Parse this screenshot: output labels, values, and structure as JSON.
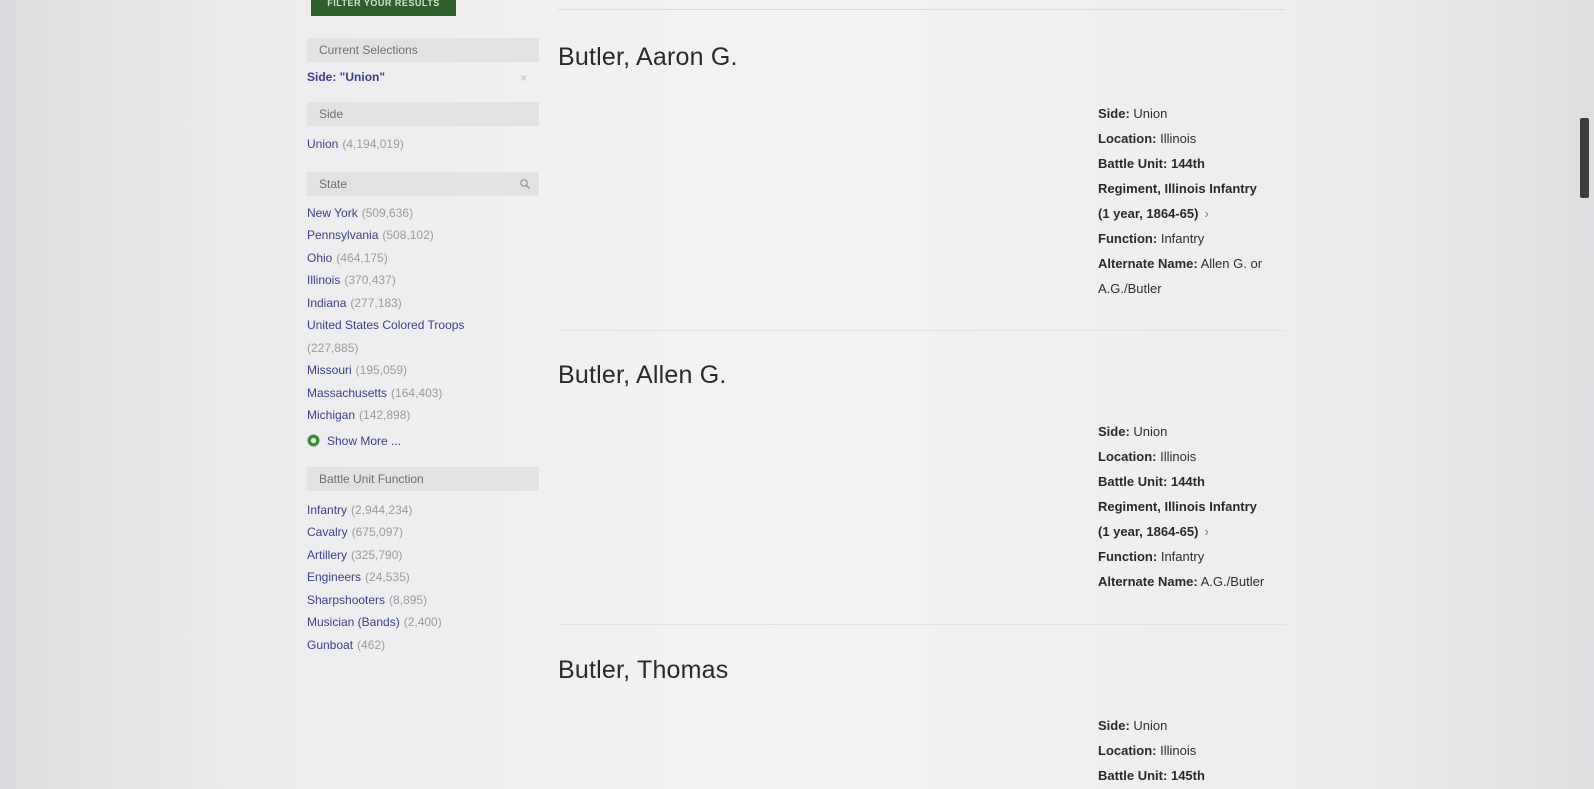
{
  "top_button": {
    "label": "FILTER YOUR RESULTS"
  },
  "current_selections": {
    "header": "Current Selections",
    "selection": "Side: \"Union\"",
    "remove_label": "×"
  },
  "side_facet": {
    "header": "Side",
    "items": [
      {
        "label": "Union",
        "count": "(4,194,019)"
      }
    ]
  },
  "state_facet": {
    "header": "State",
    "items": [
      {
        "label": "New York",
        "count": "(509,636)"
      },
      {
        "label": "Pennsylvania",
        "count": "(508,102)"
      },
      {
        "label": "Ohio",
        "count": "(464,175)"
      },
      {
        "label": "Illinois",
        "count": "(370,437)"
      },
      {
        "label": "Indiana",
        "count": "(277,183)"
      },
      {
        "label": "United States Colored Troops",
        "count": "(227,885)"
      },
      {
        "label": "Missouri",
        "count": "(195,059)"
      },
      {
        "label": "Massachusetts",
        "count": "(164,403)"
      },
      {
        "label": "Michigan",
        "count": "(142,898)"
      }
    ],
    "show_more": "Show More ..."
  },
  "function_facet": {
    "header": "Battle Unit Function",
    "items": [
      {
        "label": "Infantry",
        "count": "(2,944,234)"
      },
      {
        "label": "Cavalry",
        "count": "(675,097)"
      },
      {
        "label": "Artillery",
        "count": "(325,790)"
      },
      {
        "label": "Engineers",
        "count": "(24,535)"
      },
      {
        "label": "Sharpshooters",
        "count": "(8,895)"
      },
      {
        "label": "Musician (Bands)",
        "count": "(2,400)"
      },
      {
        "label": "Gunboat",
        "count": "(462)"
      }
    ]
  },
  "results": [
    {
      "name": "Butler, Aaron G.",
      "side_label": "Side:",
      "side": "Union",
      "location_label": "Location:",
      "location": "Illinois",
      "unit_label": "Battle Unit:",
      "unit_line1": "144th",
      "unit_line2": "Regiment, Illinois Infantry",
      "unit_line3": "(1 year, 1864-65)",
      "function_label": "Function:",
      "function": "Infantry",
      "alt_label": "Alternate Name:",
      "alt_line1": "Allen G. or",
      "alt_line2": "A.G./Butler"
    },
    {
      "name": "Butler, Allen G.",
      "side_label": "Side:",
      "side": "Union",
      "location_label": "Location:",
      "location": "Illinois",
      "unit_label": "Battle Unit:",
      "unit_line1": "144th",
      "unit_line2": "Regiment, Illinois Infantry",
      "unit_line3": "(1 year, 1864-65)",
      "function_label": "Function:",
      "function": "Infantry",
      "alt_label": "Alternate Name:",
      "alt_line1": "A.G./Butler"
    },
    {
      "name": "Butler, Thomas",
      "side_label": "Side:",
      "side": "Union",
      "location_label": "Location:",
      "location": "Illinois",
      "unit_label": "Battle Unit:",
      "unit_line1": "145th"
    }
  ],
  "chevron": "›"
}
